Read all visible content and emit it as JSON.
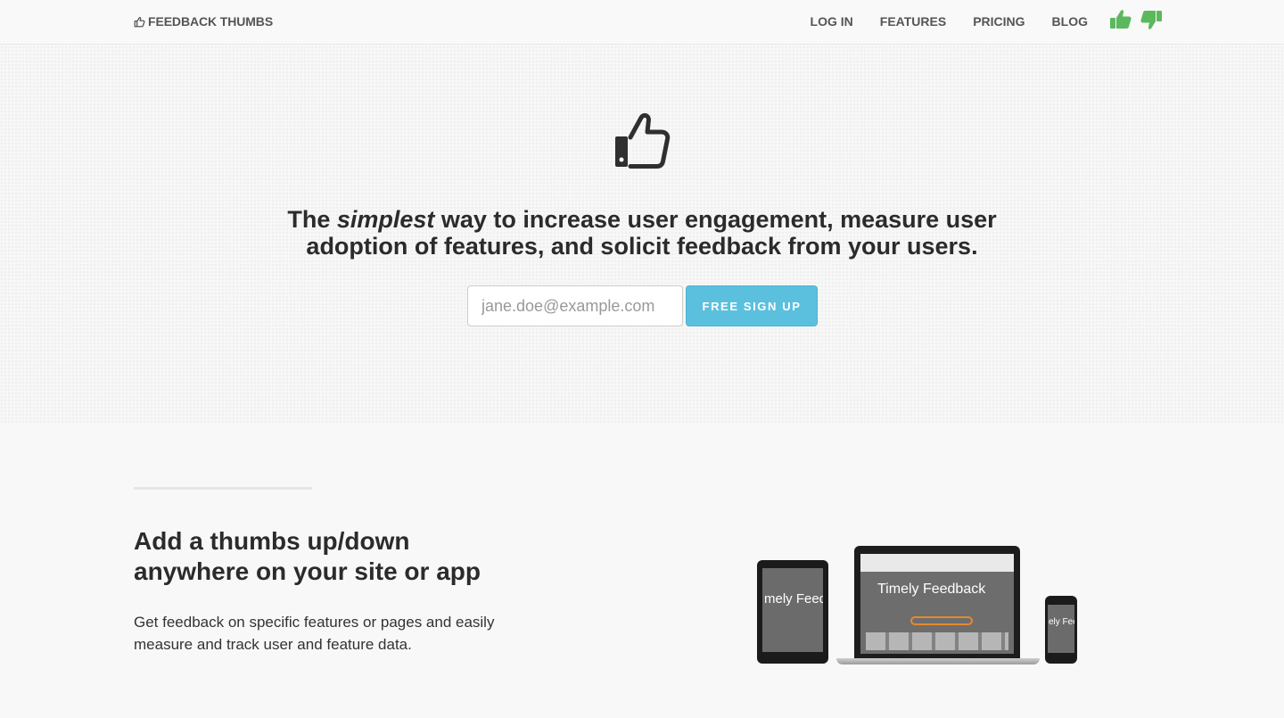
{
  "nav": {
    "brand": "FEEDBACK THUMBS",
    "links": [
      "LOG IN",
      "FEATURES",
      "PRICING",
      "BLOG"
    ],
    "thumb_color": "#5cb85c"
  },
  "hero": {
    "title_before": "The ",
    "title_em": "simplest",
    "title_after": " way to increase user engagement, measure user adoption of features, and solicit feedback from your users.",
    "email_placeholder": "jane.doe@example.com",
    "signup_label": "FREE SIGN UP",
    "accent_color": "#5bc0de"
  },
  "feature": {
    "title": "Add a thumbs up/down anywhere on your site or app",
    "text": "Get feedback on specific features or pages and easily measure and track user and feature data.",
    "devices": {
      "tablet_text": "mely Feedb",
      "laptop_text": "Timely Feedback",
      "phone_text": "ely Fee"
    }
  }
}
